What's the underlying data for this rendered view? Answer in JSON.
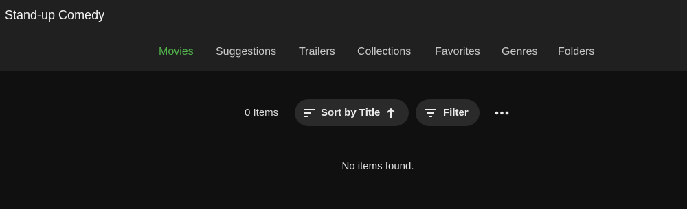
{
  "header": {
    "title": "Stand-up Comedy"
  },
  "tabs": [
    {
      "label": "Movies",
      "active": true
    },
    {
      "label": "Suggestions",
      "active": false
    },
    {
      "label": "Trailers",
      "active": false
    },
    {
      "label": "Collections",
      "active": false
    },
    {
      "label": "Favorites",
      "active": false
    },
    {
      "label": "Genres",
      "active": false
    },
    {
      "label": "Folders",
      "active": false
    }
  ],
  "toolbar": {
    "item_count": "0 Items",
    "sort_label": "Sort by Title",
    "filter_label": "Filter",
    "sort_icon": "sort-lines-icon",
    "sort_direction_icon": "arrow-up-icon",
    "filter_icon": "filter-lines-icon",
    "more_icon": "more-horizontal-icon"
  },
  "main": {
    "empty_message": "No items found."
  },
  "colors": {
    "accent": "#52b54b",
    "header_bg": "#202020",
    "page_bg": "#101010",
    "pill_bg": "#2a2a2a"
  }
}
